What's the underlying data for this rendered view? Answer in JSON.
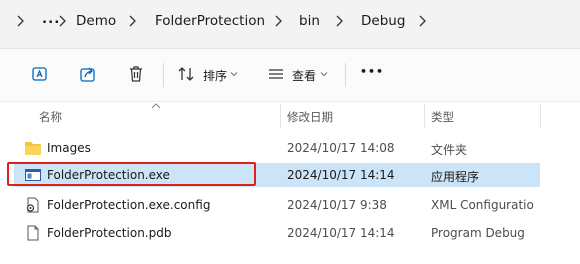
{
  "breadcrumb": {
    "overflow": "...",
    "items": [
      "Demo",
      "FolderProtection",
      "bin",
      "Debug"
    ]
  },
  "toolbar": {
    "sort_label": "排序",
    "view_label": "查看",
    "more": "•••",
    "icons": [
      "rename-icon",
      "share-icon",
      "delete-icon",
      "sort-icon",
      "view-icon",
      "more-icon"
    ]
  },
  "columns": {
    "name": "名称",
    "date": "修改日期",
    "type": "类型"
  },
  "files": [
    {
      "name": "Images",
      "date": "2024/10/17 14:08",
      "type": "文件夹",
      "icon": "folder-icon"
    },
    {
      "name": "FolderProtection.exe",
      "date": "2024/10/17 14:14",
      "type": "应用程序",
      "icon": "exe-icon",
      "selected": true
    },
    {
      "name": "FolderProtection.exe.config",
      "date": "2024/10/17 9:38",
      "type": "XML Configuratio",
      "icon": "config-file-icon"
    },
    {
      "name": "FolderProtection.pdb",
      "date": "2024/10/17 14:14",
      "type": "Program Debug",
      "icon": "pdb-file-icon"
    }
  ],
  "colors": {
    "selection": "#cce4f7",
    "highlight_frame": "#e0201b",
    "folder": "#f7c244",
    "accent": "#0067c0"
  }
}
